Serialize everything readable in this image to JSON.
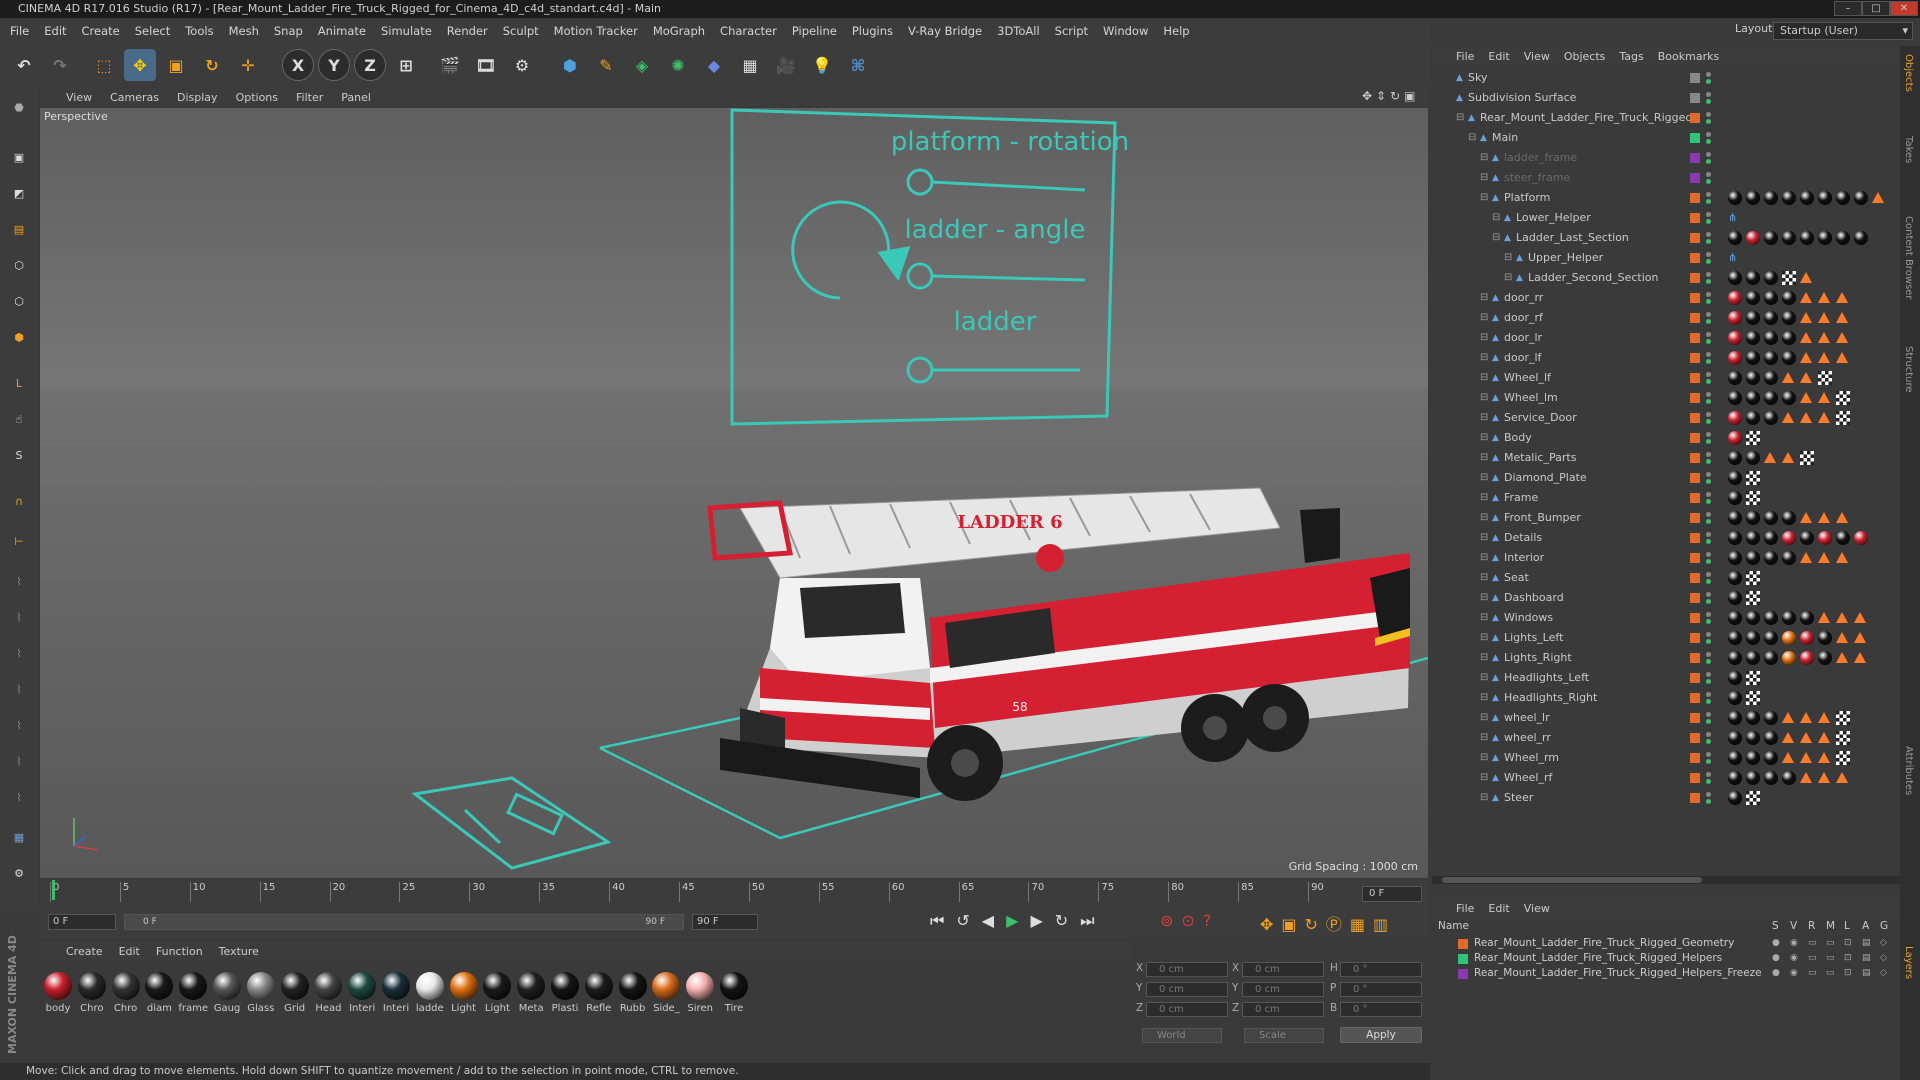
{
  "window": {
    "title": "CINEMA 4D R17.016 Studio (R17) - [Rear_Mount_Ladder_Fire_Truck_Rigged_for_Cinema_4D_c4d_standart.c4d] - Main"
  },
  "menu": [
    "File",
    "Edit",
    "Create",
    "Select",
    "Tools",
    "Mesh",
    "Snap",
    "Animate",
    "Simulate",
    "Render",
    "Sculpt",
    "Motion Tracker",
    "MoGraph",
    "Character",
    "Pipeline",
    "Plugins",
    "V-Ray Bridge",
    "3DToAll",
    "Script",
    "Window",
    "Help"
  ],
  "layout": {
    "label": "Layout:",
    "value": "Startup (User)"
  },
  "viewport": {
    "menu": [
      "View",
      "Cameras",
      "Display",
      "Options",
      "Filter",
      "Panel"
    ],
    "camera_label": "Perspective",
    "grid_spacing": "Grid Spacing : 1000 cm",
    "truck_label": "LADDER 6",
    "truck_number": "58"
  },
  "hud": {
    "platform": "platform - rotation",
    "ladder_angle": "ladder - angle",
    "ladder": "ladder"
  },
  "timeline": {
    "ticks": [
      "0",
      "5",
      "10",
      "15",
      "20",
      "25",
      "30",
      "35",
      "40",
      "45",
      "50",
      "55",
      "60",
      "65",
      "70",
      "75",
      "80",
      "85",
      "90"
    ],
    "frame_end": "0 F",
    "start_field": "0 F",
    "range_left": "0 F",
    "range_right": "90 F",
    "end_field": "90 F"
  },
  "materials": {
    "menu": [
      "Create",
      "Edit",
      "Function",
      "Texture"
    ],
    "items": [
      {
        "name": "body",
        "color": "#c8202a"
      },
      {
        "name": "Chro",
        "color": "#2a2a2a"
      },
      {
        "name": "Chro",
        "color": "#333"
      },
      {
        "name": "diam",
        "color": "#1a1a1a"
      },
      {
        "name": "frame",
        "color": "#181818"
      },
      {
        "name": "Gaug",
        "color": "#555"
      },
      {
        "name": "Glass",
        "color": "#888"
      },
      {
        "name": "Grid",
        "color": "#222"
      },
      {
        "name": "Head",
        "color": "#444"
      },
      {
        "name": "Interi",
        "color": "#1d4a44"
      },
      {
        "name": "Interi",
        "color": "#1a2f3a"
      },
      {
        "name": "ladde",
        "color": "#e8e8e8"
      },
      {
        "name": "Light",
        "color": "#e07010"
      },
      {
        "name": "Light",
        "color": "#1b1b1b"
      },
      {
        "name": "Meta",
        "color": "#202020"
      },
      {
        "name": "Plasti",
        "color": "#151515"
      },
      {
        "name": "Refle",
        "color": "#1c1c1c"
      },
      {
        "name": "Rubb",
        "color": "#151515"
      },
      {
        "name": "Side_",
        "color": "#d86a1a"
      },
      {
        "name": "Siren",
        "color": "#f7b0b0"
      },
      {
        "name": "Tire",
        "color": "#141414"
      }
    ]
  },
  "coords": {
    "rows": [
      {
        "a": "X",
        "av": "0 cm",
        "b": "X",
        "bv": "0 cm",
        "c": "H",
        "cv": "0 °"
      },
      {
        "a": "Y",
        "av": "0 cm",
        "b": "Y",
        "bv": "0 cm",
        "c": "P",
        "cv": "0 °"
      },
      {
        "a": "Z",
        "av": "0 cm",
        "b": "Z",
        "bv": "0 cm",
        "c": "B",
        "cv": "0 °"
      }
    ],
    "world": "World",
    "scale": "Scale",
    "apply": "Apply"
  },
  "status": "Move: Click and drag to move elements. Hold down SHIFT to quantize movement / add to the selection in point mode, CTRL to remove.",
  "objects": {
    "menu": [
      "File",
      "Edit",
      "View",
      "Objects",
      "Tags",
      "Bookmarks"
    ],
    "items": [
      {
        "name": "Sky",
        "indent": 0,
        "color": "#888"
      },
      {
        "name": "Subdivision Surface",
        "indent": 0,
        "color": "#888"
      },
      {
        "name": "Rear_Mount_Ladder_Fire_Truck_Rigged",
        "indent": 1,
        "color": "#e06a2a"
      },
      {
        "name": "Main",
        "indent": 2,
        "color": "#2ec47a"
      },
      {
        "name": "ladder_frame",
        "indent": 3,
        "color": "#8a3ab0",
        "dim": true
      },
      {
        "name": "steer_frame",
        "indent": 3,
        "color": "#8a3ab0",
        "dim": true
      },
      {
        "name": "Platform",
        "indent": 3,
        "color": "#e06a2a"
      },
      {
        "name": "Lower_Helper",
        "indent": 4,
        "color": "#e06a2a"
      },
      {
        "name": "Ladder_Last_Section",
        "indent": 4,
        "color": "#e06a2a"
      },
      {
        "name": "Upper_Helper",
        "indent": 5,
        "color": "#e06a2a"
      },
      {
        "name": "Ladder_Second_Section",
        "indent": 5,
        "color": "#e06a2a"
      },
      {
        "name": "door_rr",
        "indent": 3,
        "color": "#e06a2a"
      },
      {
        "name": "door_rf",
        "indent": 3,
        "color": "#e06a2a"
      },
      {
        "name": "door_lr",
        "indent": 3,
        "color": "#e06a2a"
      },
      {
        "name": "door_lf",
        "indent": 3,
        "color": "#e06a2a"
      },
      {
        "name": "Wheel_lf",
        "indent": 3,
        "color": "#e06a2a"
      },
      {
        "name": "Wheel_lm",
        "indent": 3,
        "color": "#e06a2a"
      },
      {
        "name": "Service_Door",
        "indent": 3,
        "color": "#e06a2a"
      },
      {
        "name": "Body",
        "indent": 3,
        "color": "#e06a2a"
      },
      {
        "name": "Metalic_Parts",
        "indent": 3,
        "color": "#e06a2a"
      },
      {
        "name": "Diamond_Plate",
        "indent": 3,
        "color": "#e06a2a"
      },
      {
        "name": "Frame",
        "indent": 3,
        "color": "#e06a2a"
      },
      {
        "name": "Front_Bumper",
        "indent": 3,
        "color": "#e06a2a"
      },
      {
        "name": "Details",
        "indent": 3,
        "color": "#e06a2a"
      },
      {
        "name": "Interior",
        "indent": 3,
        "color": "#e06a2a"
      },
      {
        "name": "Seat",
        "indent": 3,
        "color": "#e06a2a"
      },
      {
        "name": "Dashboard",
        "indent": 3,
        "color": "#e06a2a"
      },
      {
        "name": "Windows",
        "indent": 3,
        "color": "#e06a2a"
      },
      {
        "name": "Lights_Left",
        "indent": 3,
        "color": "#e06a2a"
      },
      {
        "name": "Lights_Right",
        "indent": 3,
        "color": "#e06a2a"
      },
      {
        "name": "Headlights_Left",
        "indent": 3,
        "color": "#e06a2a"
      },
      {
        "name": "Headlights_Right",
        "indent": 3,
        "color": "#e06a2a"
      },
      {
        "name": "wheel_lr",
        "indent": 3,
        "color": "#e06a2a"
      },
      {
        "name": "wheel_rr",
        "indent": 3,
        "color": "#e06a2a"
      },
      {
        "name": "Wheel_rm",
        "indent": 3,
        "color": "#e06a2a"
      },
      {
        "name": "Wheel_rf",
        "indent": 3,
        "color": "#e06a2a"
      },
      {
        "name": "Steer",
        "indent": 3,
        "color": "#e06a2a"
      }
    ]
  },
  "layers": {
    "menu": [
      "File",
      "Edit",
      "View"
    ],
    "header": {
      "name": "Name",
      "cols": [
        "S",
        "V",
        "R",
        "M",
        "L",
        "A",
        "G"
      ]
    },
    "items": [
      {
        "name": "Rear_Mount_Ladder_Fire_Truck_Rigged_Geometry",
        "color": "#e06a2a"
      },
      {
        "name": "Rear_Mount_Ladder_Fire_Truck_Rigged_Helpers",
        "color": "#2ec47a"
      },
      {
        "name": "Rear_Mount_Ladder_Fire_Truck_Rigged_Helpers_Freeze",
        "color": "#8a3ab0"
      }
    ]
  },
  "side_tabs": [
    "Objects",
    "Takes",
    "Content Browser",
    "Structure",
    "Attributes",
    "Layers"
  ],
  "brand": "MAXON CINEMA 4D"
}
